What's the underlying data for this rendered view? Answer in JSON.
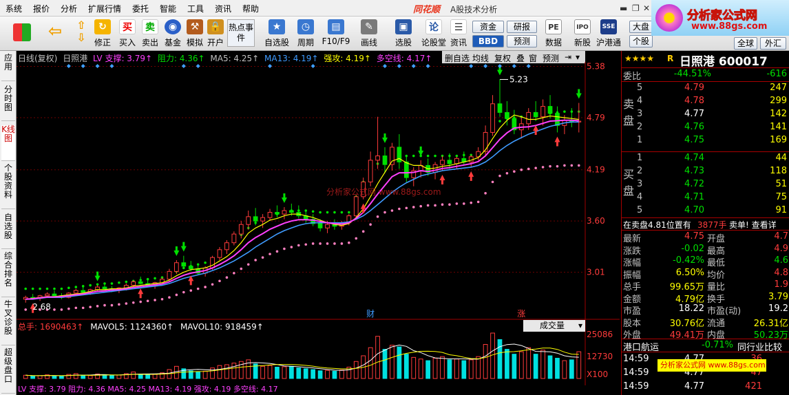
{
  "menu": [
    "系统",
    "报价",
    "分析",
    "扩展行情",
    "委托",
    "智能",
    "工具",
    "资讯",
    "帮助"
  ],
  "app": {
    "brand": "同花顺",
    "title": "A股技术分析",
    "window_controls": [
      "▬",
      "❐",
      "✕"
    ]
  },
  "banner": {
    "title": "分析家公式网",
    "url": "www.88gs.com"
  },
  "toolbar": {
    "buttons": [
      {
        "label": "",
        "icon": "grid-icon"
      },
      {
        "label": "",
        "icon": "back-arrow-icon"
      },
      {
        "label": "",
        "icon": "up-down-arrows-icon"
      },
      {
        "label": "修正",
        "icon": "refresh-icon"
      },
      {
        "label": "买入",
        "icon": "buy-icon",
        "glyph": "买"
      },
      {
        "label": "卖出",
        "icon": "sell-icon",
        "glyph": "卖"
      },
      {
        "label": "基金",
        "icon": "fund-icon"
      },
      {
        "label": "模拟",
        "icon": "hammer-icon"
      },
      {
        "label": "开户",
        "icon": "lock-icon"
      },
      {
        "label": "热点事件",
        "icon": "hot-events-icon"
      },
      {
        "label": "自选股",
        "icon": "star-list-icon"
      },
      {
        "label": "周期",
        "icon": "clock-icon"
      },
      {
        "label": "F10/F9",
        "icon": "f10-icon"
      },
      {
        "label": "画线",
        "icon": "pencil-icon"
      },
      {
        "label": "选股",
        "icon": "select-stock-icon"
      },
      {
        "label": "论股堂",
        "icon": "forum-icon",
        "glyph": "论"
      },
      {
        "label": "资讯",
        "icon": "news-icon"
      },
      {
        "label": "数据",
        "icon": "pe-data-icon",
        "glyph": "PE"
      },
      {
        "label": "新股",
        "icon": "ipo-icon",
        "glyph": "IPO"
      },
      {
        "label": "沪港通",
        "icon": "sse-hkex-icon",
        "glyph": "SSE"
      }
    ],
    "small_buttons": {
      "fund": "资金",
      "research": "研报",
      "bbd": "BBD",
      "forecast": "预测",
      "market": "大盘",
      "global": "全球",
      "stock": "个股",
      "foreign": "外汇"
    }
  },
  "left_tabs": [
    "应用",
    "分时图",
    "K线图",
    "个股资料",
    "自选股",
    "综合排名",
    "牛叉诊股",
    "超级盘口"
  ],
  "chart": {
    "header": [
      {
        "text": "日线(复权)",
        "color": "#c0c0c0"
      },
      {
        "text": "日照港",
        "color": "#c0c0c0"
      },
      {
        "text": "LV 支撑: 3.79↑",
        "color": "#ff40ff"
      },
      {
        "text": "阻力: 4.36↑",
        "color": "#00e000"
      },
      {
        "text": "MA5: 4.25↑",
        "color": "#c0c0c0"
      },
      {
        "text": "MA13: 4.19↑",
        "color": "#3f9bff"
      },
      {
        "text": "强攻: 4.19↑",
        "color": "#ffff00"
      },
      {
        "text": "多空线: 4.17↑",
        "color": "#ff40ff"
      }
    ],
    "tools": [
      "删自选",
      "均线",
      "复权",
      "叠",
      "窗",
      "预测"
    ],
    "price_labels": [
      "5.38",
      "4.79",
      "4.19",
      "3.60",
      "3.01"
    ],
    "high_label": "5.23",
    "low_label": "2.68",
    "markers": [
      "财",
      "涨"
    ],
    "watermark": "分析家公式网 www.88gs.com"
  },
  "volume": {
    "header": [
      {
        "text": "总手: 1690463↑",
        "color": "#ff3b3b"
      },
      {
        "text": "MAVOL5: 1124360↑",
        "color": "#ffffff"
      },
      {
        "text": "MAVOL10: 918459↑",
        "color": "#ffffff"
      }
    ],
    "select_label": "成交量",
    "axis_labels": [
      "25086",
      "12730",
      "X100"
    ],
    "footer_text": "LV 支撑: 3.79  阻力: 4.36  MA5: 4.25  MA13: 4.19  强攻: 4.19  多空线: 4.17"
  },
  "quote": {
    "stars": "★★★★",
    "rating": "R",
    "name": "日照港 600017",
    "weibi": {
      "label": "委比",
      "value": "-44.51%",
      "diff": "-616"
    },
    "sell_label": "卖盘",
    "buy_label": "买盘",
    "sell": [
      {
        "lvl": "5",
        "price": "4.79",
        "vol": "247"
      },
      {
        "lvl": "4",
        "price": "4.78",
        "vol": "299"
      },
      {
        "lvl": "3",
        "price": "4.77",
        "vol": "142"
      },
      {
        "lvl": "2",
        "price": "4.76",
        "vol": "141"
      },
      {
        "lvl": "1",
        "price": "4.75",
        "vol": "169"
      }
    ],
    "buy": [
      {
        "lvl": "1",
        "price": "4.74",
        "vol": "44"
      },
      {
        "lvl": "2",
        "price": "4.73",
        "vol": "118"
      },
      {
        "lvl": "3",
        "price": "4.72",
        "vol": "51"
      },
      {
        "lvl": "4",
        "price": "4.71",
        "vol": "75"
      },
      {
        "lvl": "5",
        "price": "4.70",
        "vol": "91"
      }
    ],
    "notice": {
      "left": "在卖盘4.81位置有",
      "mid": "3877手",
      "right": "卖单! 查看详"
    },
    "stats": [
      {
        "l1": "最新",
        "v1": "4.75",
        "c1": "up",
        "l2": "开盘",
        "v2": "4.7",
        "c2": "up"
      },
      {
        "l1": "涨跌",
        "v1": "-0.02",
        "c1": "down",
        "l2": "最高",
        "v2": "4.9",
        "c2": "up"
      },
      {
        "l1": "涨幅",
        "v1": "-0.42%",
        "c1": "down",
        "l2": "最低",
        "v2": "4.6",
        "c2": "down"
      },
      {
        "l1": "振幅",
        "v1": "6.50%",
        "c1": "yellow",
        "l2": "均价",
        "v2": "4.8",
        "c2": "up"
      },
      {
        "l1": "总手",
        "v1": "99.65万",
        "c1": "yellow",
        "l2": "量比",
        "v2": "1.9",
        "c2": "up"
      },
      {
        "l1": "金额",
        "v1": "4.79亿",
        "c1": "yellow",
        "l2": "换手",
        "v2": "3.79",
        "c2": "yellow"
      },
      {
        "l1": "市盈",
        "v1": "18.22",
        "c1": "white",
        "l2": "市盈(动)",
        "v2": "19.2",
        "c2": "white"
      },
      {
        "l1": "股本",
        "v1": "30.76亿",
        "c1": "yellow",
        "l2": "流通",
        "v2": "26.31亿",
        "c2": "yellow"
      },
      {
        "l1": "外盘",
        "v1": "49.41万",
        "c1": "up",
        "l2": "内盘",
        "v2": "50.23万",
        "c2": "down"
      }
    ],
    "sector": {
      "name": "港口航运",
      "change": "-0.71%",
      "compare": "同行业比较"
    },
    "ticks": [
      {
        "time": "14:59",
        "price": "4.77",
        "vol": "36"
      },
      {
        "time": "14:59",
        "price": "4.77",
        "vol": "47"
      },
      {
        "time": "14:59",
        "price": "4.77",
        "vol": "421"
      }
    ],
    "watermark": "分析家公式网 www.88gs.com"
  },
  "colors": {
    "up": "#ff3b3b",
    "down": "#00e000",
    "ma5": "#ffffff",
    "ma13": "#3f9bff",
    "strong": "#ffff00",
    "trend": "#ff40ff",
    "support_dots": "#ff80c0",
    "resist_dots": "#00e000",
    "grid": "#700000"
  },
  "chart_data": {
    "type": "candlestick",
    "price_axis": [
      5.38,
      4.79,
      4.19,
      3.6,
      3.01
    ],
    "ohlc": [
      [
        2.7,
        2.74,
        2.66,
        2.72
      ],
      [
        2.72,
        2.76,
        2.7,
        2.71
      ],
      [
        2.71,
        2.75,
        2.68,
        2.74
      ],
      [
        2.74,
        2.78,
        2.72,
        2.76
      ],
      [
        2.76,
        2.8,
        2.73,
        2.74
      ],
      [
        2.74,
        2.77,
        2.7,
        2.72
      ],
      [
        2.72,
        2.78,
        2.71,
        2.77
      ],
      [
        2.77,
        2.82,
        2.75,
        2.8
      ],
      [
        2.8,
        2.84,
        2.77,
        2.78
      ],
      [
        2.78,
        2.82,
        2.75,
        2.81
      ],
      [
        2.81,
        2.86,
        2.79,
        2.84
      ],
      [
        2.84,
        2.88,
        2.81,
        2.82
      ],
      [
        2.82,
        2.85,
        2.78,
        2.8
      ],
      [
        2.8,
        2.84,
        2.77,
        2.83
      ],
      [
        2.83,
        2.88,
        2.8,
        2.86
      ],
      [
        2.86,
        2.92,
        2.84,
        2.9
      ],
      [
        2.9,
        2.96,
        2.87,
        2.88
      ],
      [
        2.88,
        2.92,
        2.84,
        2.86
      ],
      [
        2.86,
        2.9,
        2.82,
        2.89
      ],
      [
        2.89,
        2.95,
        2.87,
        2.93
      ],
      [
        2.93,
        3.05,
        2.91,
        3.02
      ],
      [
        3.02,
        3.15,
        2.99,
        3.12
      ],
      [
        3.12,
        3.2,
        3.05,
        3.08
      ],
      [
        3.08,
        3.14,
        3.02,
        3.05
      ],
      [
        3.05,
        3.1,
        2.98,
        3.0
      ],
      [
        3.0,
        3.08,
        2.96,
        3.06
      ],
      [
        3.06,
        3.2,
        3.04,
        3.18
      ],
      [
        3.18,
        3.3,
        3.15,
        3.27
      ],
      [
        3.27,
        3.38,
        3.22,
        3.35
      ],
      [
        3.35,
        3.48,
        3.32,
        3.45
      ],
      [
        3.45,
        3.6,
        3.4,
        3.56
      ],
      [
        3.56,
        3.72,
        3.5,
        3.65
      ],
      [
        3.65,
        3.75,
        3.55,
        3.6
      ],
      [
        3.6,
        3.68,
        3.52,
        3.64
      ],
      [
        3.64,
        3.74,
        3.6,
        3.7
      ],
      [
        3.7,
        3.78,
        3.64,
        3.68
      ],
      [
        3.68,
        3.76,
        3.62,
        3.72
      ],
      [
        3.72,
        3.8,
        3.66,
        3.7
      ],
      [
        3.7,
        3.78,
        3.63,
        3.66
      ],
      [
        3.66,
        3.72,
        3.58,
        3.62
      ],
      [
        3.62,
        3.68,
        3.54,
        3.57
      ],
      [
        3.57,
        3.62,
        3.48,
        3.52
      ],
      [
        3.52,
        3.6,
        3.46,
        3.56
      ],
      [
        3.56,
        3.62,
        3.5,
        3.54
      ],
      [
        3.54,
        3.6,
        3.5,
        3.58
      ],
      [
        3.58,
        3.68,
        3.55,
        3.66
      ],
      [
        3.66,
        3.9,
        3.64,
        3.88
      ],
      [
        3.88,
        4.1,
        3.85,
        4.05
      ],
      [
        4.05,
        4.4,
        4.0,
        4.3
      ],
      [
        4.3,
        4.8,
        4.2,
        4.35
      ],
      [
        4.35,
        4.45,
        4.15,
        4.25
      ],
      [
        4.25,
        4.5,
        4.18,
        4.45
      ],
      [
        4.45,
        4.6,
        4.2,
        4.28
      ],
      [
        4.28,
        4.36,
        4.05,
        4.1
      ],
      [
        4.1,
        4.22,
        4.0,
        4.18
      ],
      [
        4.18,
        4.3,
        4.1,
        4.24
      ],
      [
        4.24,
        4.32,
        4.12,
        4.16
      ],
      [
        4.16,
        4.28,
        4.08,
        4.25
      ],
      [
        4.25,
        4.35,
        4.18,
        4.3
      ],
      [
        4.3,
        4.38,
        4.2,
        4.26
      ],
      [
        4.26,
        4.34,
        4.2,
        4.32
      ],
      [
        4.32,
        4.4,
        4.25,
        4.28
      ],
      [
        4.28,
        4.36,
        4.22,
        4.34
      ],
      [
        4.34,
        4.45,
        4.3,
        4.4
      ],
      [
        4.4,
        4.7,
        4.35,
        4.62
      ],
      [
        4.62,
        5.05,
        4.58,
        4.95
      ],
      [
        4.95,
        5.23,
        4.8,
        4.85
      ],
      [
        4.85,
        4.98,
        4.7,
        4.78
      ],
      [
        4.78,
        4.88,
        4.6,
        4.65
      ],
      [
        4.65,
        4.8,
        4.55,
        4.72
      ],
      [
        4.72,
        4.9,
        4.65,
        4.85
      ],
      [
        4.85,
        4.98,
        4.75,
        4.8
      ],
      [
        4.8,
        5.0,
        4.7,
        4.92
      ],
      [
        4.92,
        5.05,
        4.78,
        4.84
      ],
      [
        4.84,
        4.92,
        4.62,
        4.7
      ],
      [
        4.7,
        4.82,
        4.6,
        4.76
      ],
      [
        4.76,
        4.9,
        4.68,
        4.74
      ],
      [
        4.74,
        4.96,
        4.62,
        4.75
      ]
    ],
    "volume": [
      40,
      30,
      35,
      45,
      30,
      28,
      50,
      60,
      40,
      35,
      55,
      48,
      38,
      42,
      60,
      80,
      55,
      45,
      50,
      70,
      110,
      150,
      120,
      95,
      85,
      90,
      130,
      160,
      170,
      190,
      210,
      230,
      180,
      150,
      160,
      140,
      145,
      150,
      130,
      120,
      110,
      95,
      100,
      90,
      105,
      140,
      210,
      280,
      380,
      520,
      360,
      410,
      390,
      300,
      260,
      240,
      220,
      250,
      270,
      230,
      240,
      220,
      230,
      270,
      420,
      560,
      480,
      360,
      300,
      330,
      380,
      300,
      350,
      280,
      250,
      220,
      230,
      330
    ],
    "ma5": [
      2.7,
      2.71,
      2.72,
      2.73,
      2.73,
      2.74,
      2.75,
      2.76,
      2.77,
      2.79,
      2.81,
      2.81,
      2.82,
      2.82,
      2.83,
      2.85,
      2.86,
      2.87,
      2.88,
      2.89,
      2.92,
      2.97,
      3.01,
      3.04,
      3.05,
      3.06,
      3.09,
      3.14,
      3.19,
      3.26,
      3.35,
      3.46,
      3.52,
      3.56,
      3.61,
      3.63,
      3.66,
      3.68,
      3.68,
      3.66,
      3.64,
      3.61,
      3.58,
      3.56,
      3.55,
      3.57,
      3.64,
      3.74,
      3.88,
      4.03,
      4.16,
      4.29,
      4.32,
      4.27,
      4.24,
      4.24,
      4.2,
      4.21,
      4.23,
      4.24,
      4.26,
      4.28,
      4.3,
      4.33,
      4.42,
      4.55,
      4.67,
      4.76,
      4.82,
      4.8,
      4.77,
      4.77,
      4.79,
      4.81,
      4.8,
      4.79,
      4.78,
      4.77
    ],
    "ma13": [
      2.7,
      2.7,
      2.71,
      2.72,
      2.72,
      2.72,
      2.73,
      2.74,
      2.75,
      2.76,
      2.77,
      2.78,
      2.79,
      2.8,
      2.81,
      2.82,
      2.83,
      2.84,
      2.85,
      2.86,
      2.88,
      2.91,
      2.94,
      2.96,
      2.98,
      3.0,
      3.03,
      3.06,
      3.1,
      3.14,
      3.19,
      3.24,
      3.3,
      3.35,
      3.4,
      3.45,
      3.49,
      3.52,
      3.55,
      3.57,
      3.58,
      3.58,
      3.58,
      3.58,
      3.58,
      3.59,
      3.62,
      3.66,
      3.72,
      3.79,
      3.86,
      3.93,
      3.99,
      4.04,
      4.08,
      4.12,
      4.14,
      4.16,
      4.18,
      4.19,
      4.2,
      4.21,
      4.22,
      4.24,
      4.28,
      4.34,
      4.41,
      4.47,
      4.52,
      4.56,
      4.6,
      4.63,
      4.66,
      4.69,
      4.71,
      4.73,
      4.74,
      4.74
    ],
    "support_dots": [
      2.58,
      2.58,
      2.58,
      2.58,
      2.58,
      2.58,
      2.59,
      2.6,
      2.6,
      2.61,
      2.62,
      2.63,
      2.63,
      2.64,
      2.65,
      2.66,
      2.67,
      2.68,
      2.69,
      2.7,
      2.72,
      2.75,
      2.78,
      2.8,
      2.82,
      2.84,
      2.87,
      2.91,
      2.95,
      3.0,
      3.05,
      3.1,
      3.15,
      3.18,
      3.22,
      3.25,
      3.28,
      3.3,
      3.32,
      3.33,
      3.34,
      3.34,
      3.34,
      3.34,
      3.34,
      3.35,
      3.4,
      3.48,
      3.56,
      3.65,
      3.7,
      3.72,
      3.74,
      3.75,
      3.76,
      3.77,
      3.78,
      3.78,
      3.79,
      3.79,
      3.8,
      3.8,
      3.81,
      3.82,
      3.92,
      4.05,
      4.12,
      4.15,
      4.17,
      4.19,
      4.2,
      4.21,
      4.22,
      4.23,
      4.23,
      4.24,
      4.24,
      4.24
    ],
    "resist_dots": [
      2.82,
      2.82,
      2.82,
      2.82,
      2.82,
      2.82,
      2.83,
      2.84,
      2.85,
      2.86,
      2.87,
      2.88,
      2.88,
      2.89,
      2.9,
      2.91,
      2.92,
      2.93,
      2.94,
      2.95,
      2.98,
      3.02,
      3.06,
      3.08,
      3.1,
      3.12,
      3.16,
      3.22,
      3.28,
      3.36,
      3.44,
      3.52,
      3.58,
      3.62,
      3.66,
      3.68,
      3.7,
      3.72,
      3.72,
      3.72,
      3.71,
      3.7,
      3.7,
      3.7,
      3.7,
      3.7,
      3.88,
      4.05,
      4.15,
      4.26,
      4.32,
      4.34,
      4.35,
      4.35,
      4.35,
      4.35,
      4.35,
      4.35,
      4.35,
      4.35,
      4.35,
      4.36,
      4.36,
      4.36,
      4.55,
      4.7,
      4.75,
      4.78,
      4.79,
      4.8,
      4.81,
      4.82,
      4.83,
      4.84,
      4.85,
      4.86,
      4.86,
      4.86
    ]
  }
}
